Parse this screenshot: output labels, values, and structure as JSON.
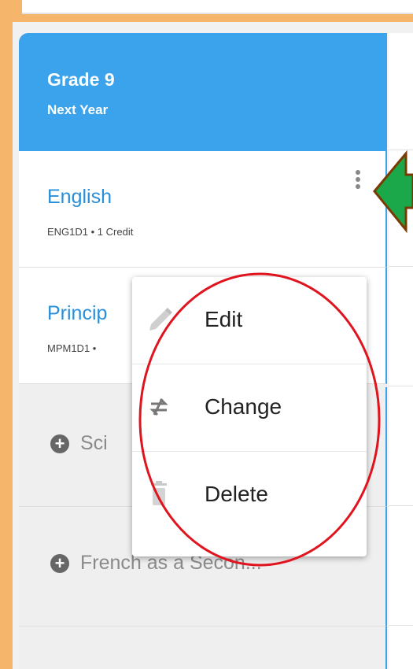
{
  "header": {
    "title": "Grade 9",
    "subtitle": "Next Year"
  },
  "courses": [
    {
      "name": "English",
      "code": "ENG1D1 • 1 Credit"
    },
    {
      "name": "Princip",
      "code": "MPM1D1 •"
    }
  ],
  "empty_slots": [
    {
      "label": "Sci"
    },
    {
      "label": "French as a Secon..."
    }
  ],
  "menu": {
    "items": [
      {
        "label": "Edit",
        "icon": "pencil-icon"
      },
      {
        "label": "Change",
        "icon": "swap-arrows-icon"
      },
      {
        "label": "Delete",
        "icon": "trash-icon"
      }
    ]
  },
  "annotations": {
    "arrow_color": "#1aa84b",
    "ellipse_color": "#e0141e"
  },
  "colors": {
    "accent": "#3aa3ec",
    "course_name": "#2a8fd8",
    "background": "#f5b56b"
  }
}
